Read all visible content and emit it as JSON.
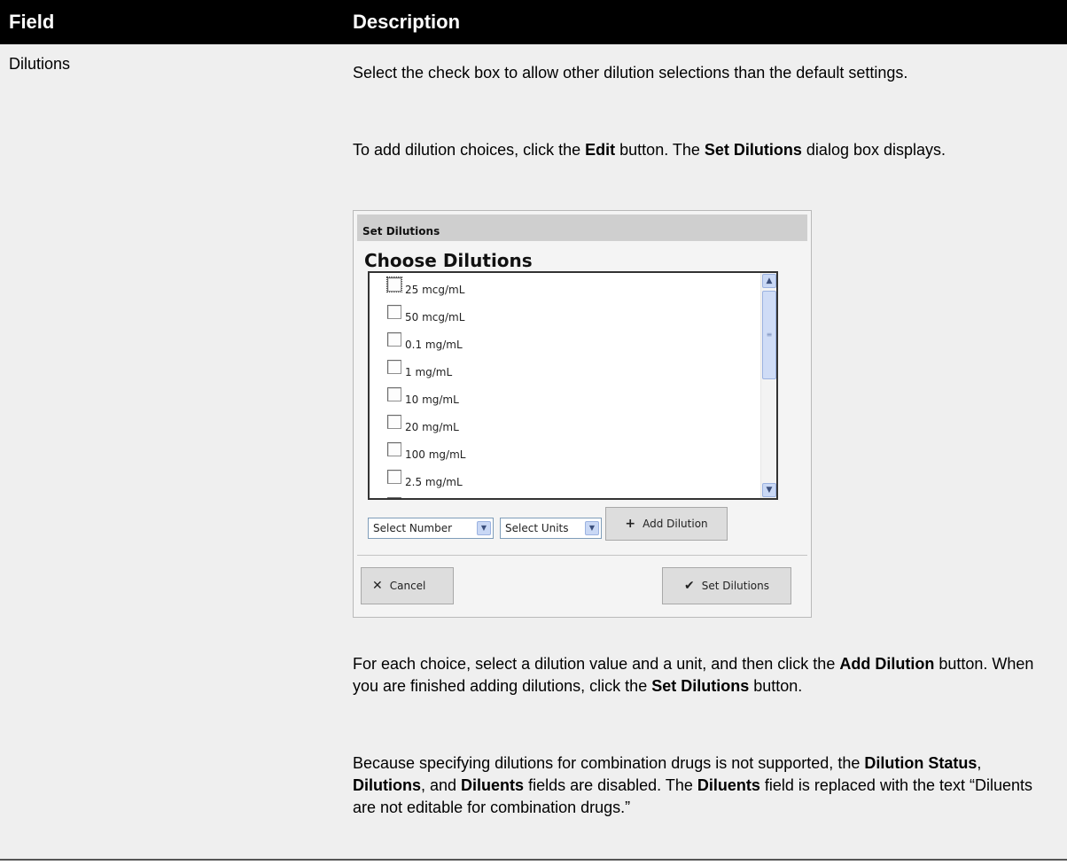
{
  "table": {
    "headers": {
      "field": "Field",
      "description": "Description"
    },
    "field_name": "Dilutions",
    "paragraphs": [
      [
        {
          "t": "Select the check box to allow other dilution selections than the default settings.",
          "b": false
        }
      ],
      [
        {
          "t": "To add dilution choices, click the ",
          "b": false
        },
        {
          "t": "Edit",
          "b": true
        },
        {
          "t": " button. The ",
          "b": false
        },
        {
          "t": "Set Dilutions",
          "b": true
        },
        {
          "t": " dialog box displays.",
          "b": false
        }
      ],
      [
        {
          "t": "For each choice, select a dilution value and a unit, and then click the ",
          "b": false
        },
        {
          "t": "Add Dilution",
          "b": true
        },
        {
          "t": " button. When you are finished adding dilutions, click the ",
          "b": false
        },
        {
          "t": "Set Dilutions",
          "b": true
        },
        {
          "t": " button.",
          "b": false
        }
      ],
      [
        {
          "t": "Because specifying dilutions for combination drugs is not supported, the ",
          "b": false
        },
        {
          "t": "Dilution Status",
          "b": true
        },
        {
          "t": ", ",
          "b": false
        },
        {
          "t": "Dilutions",
          "b": true
        },
        {
          "t": ", and ",
          "b": false
        },
        {
          "t": "Diluents",
          "b": true
        },
        {
          "t": " fields are disabled. The ",
          "b": false
        },
        {
          "t": "Diluents",
          "b": true
        },
        {
          "t": " field is replaced with the text “Diluents are not editable for combination drugs.”",
          "b": false
        }
      ]
    ]
  },
  "dialog": {
    "title": "Set Dilutions",
    "heading": "Choose Dilutions",
    "options": [
      {
        "label": "25 mcg/mL",
        "checked": false
      },
      {
        "label": "50 mcg/mL",
        "checked": false
      },
      {
        "label": "0.1 mg/mL",
        "checked": false
      },
      {
        "label": "1 mg/mL",
        "checked": false
      },
      {
        "label": "10 mg/mL",
        "checked": false
      },
      {
        "label": "20 mg/mL",
        "checked": false
      },
      {
        "label": "100 mg/mL",
        "checked": false
      },
      {
        "label": "2.5 mg/mL",
        "checked": false
      },
      {
        "label": "",
        "checked": false
      }
    ],
    "select_number": "Select Number",
    "select_units": "Select Units",
    "add_button": "Add Dilution",
    "cancel_button": "Cancel",
    "set_button": "Set Dilutions"
  }
}
